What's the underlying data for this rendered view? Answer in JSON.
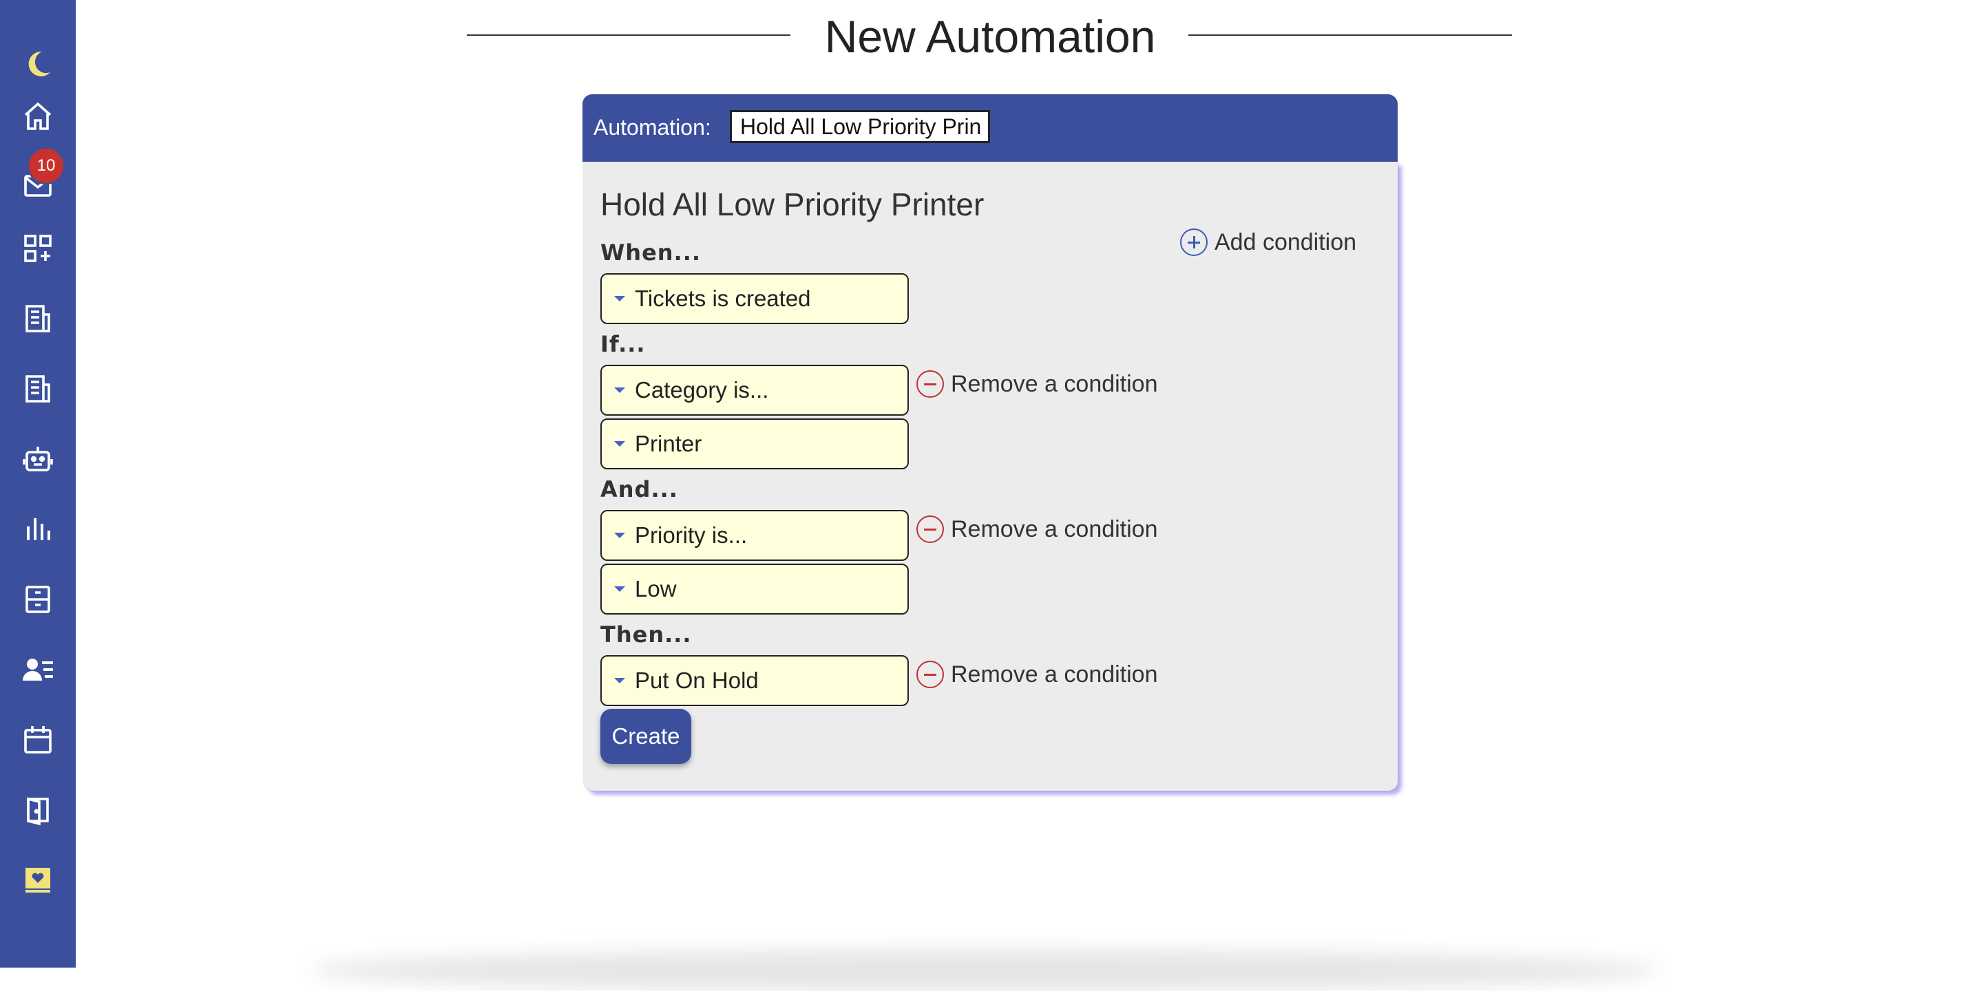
{
  "sidebar": {
    "items": [
      {
        "icon": "moon-icon"
      },
      {
        "icon": "home-icon"
      },
      {
        "icon": "mail-icon",
        "badge": "10"
      },
      {
        "icon": "add-widget-icon"
      },
      {
        "icon": "article-icon"
      },
      {
        "icon": "article-icon"
      },
      {
        "icon": "robot-icon"
      },
      {
        "icon": "bar-chart-icon"
      },
      {
        "icon": "archive-icon"
      },
      {
        "icon": "contacts-icon"
      },
      {
        "icon": "calendar-icon"
      },
      {
        "icon": "door-icon"
      },
      {
        "icon": "heart-monitor-icon"
      }
    ],
    "accent_color": "#3b4f9d",
    "icon_color": "#ffffff",
    "moon_color": "#f2e27c"
  },
  "header": {
    "title": "New Automation"
  },
  "card": {
    "name_label": "Automation:",
    "name_value": "Hold All Low Priority Prin",
    "title": "Hold All Low Priority Printer",
    "add_condition_label": "Add condition",
    "when_label": "When...",
    "when_value": "Tickets is created",
    "if_label": "If...",
    "if_field": "Category is...",
    "if_value": "Printer",
    "and_label": "And...",
    "and_field": "Priority is...",
    "and_value": "Low",
    "then_label": "Then...",
    "then_value": "Put On Hold",
    "remove_condition_label": "Remove a condition",
    "create_label": "Create",
    "select_bg": "#ffffdc"
  }
}
